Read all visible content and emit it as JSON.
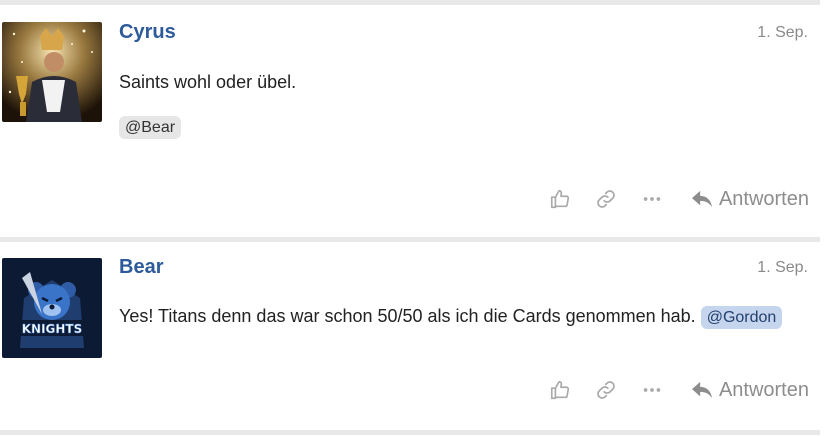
{
  "posts": [
    {
      "username": "Cyrus",
      "date": "1. Sep.",
      "message": "Saints wohl oder übel.",
      "mention": "@Bear",
      "reply_label": "Antworten"
    },
    {
      "username": "Bear",
      "date": "1. Sep.",
      "message": "Yes! Titans denn das war schon 50/50 als ich die Cards genommen hab.",
      "mention": "@Gordon",
      "avatar_text": "KNIGHTS",
      "reply_label": "Antworten"
    }
  ],
  "icons": {
    "like": "thumbs-up-icon",
    "link": "link-icon",
    "more": "more-dots-icon",
    "reply": "reply-arrow-icon"
  },
  "colors": {
    "username": "#2d5a9a",
    "date": "#8a8a8a",
    "divider": "#e8e8e8",
    "mention_grey": "#e6e6e6",
    "mention_blue": "#c5d5ee",
    "action_icon": "#aaaaaa"
  }
}
